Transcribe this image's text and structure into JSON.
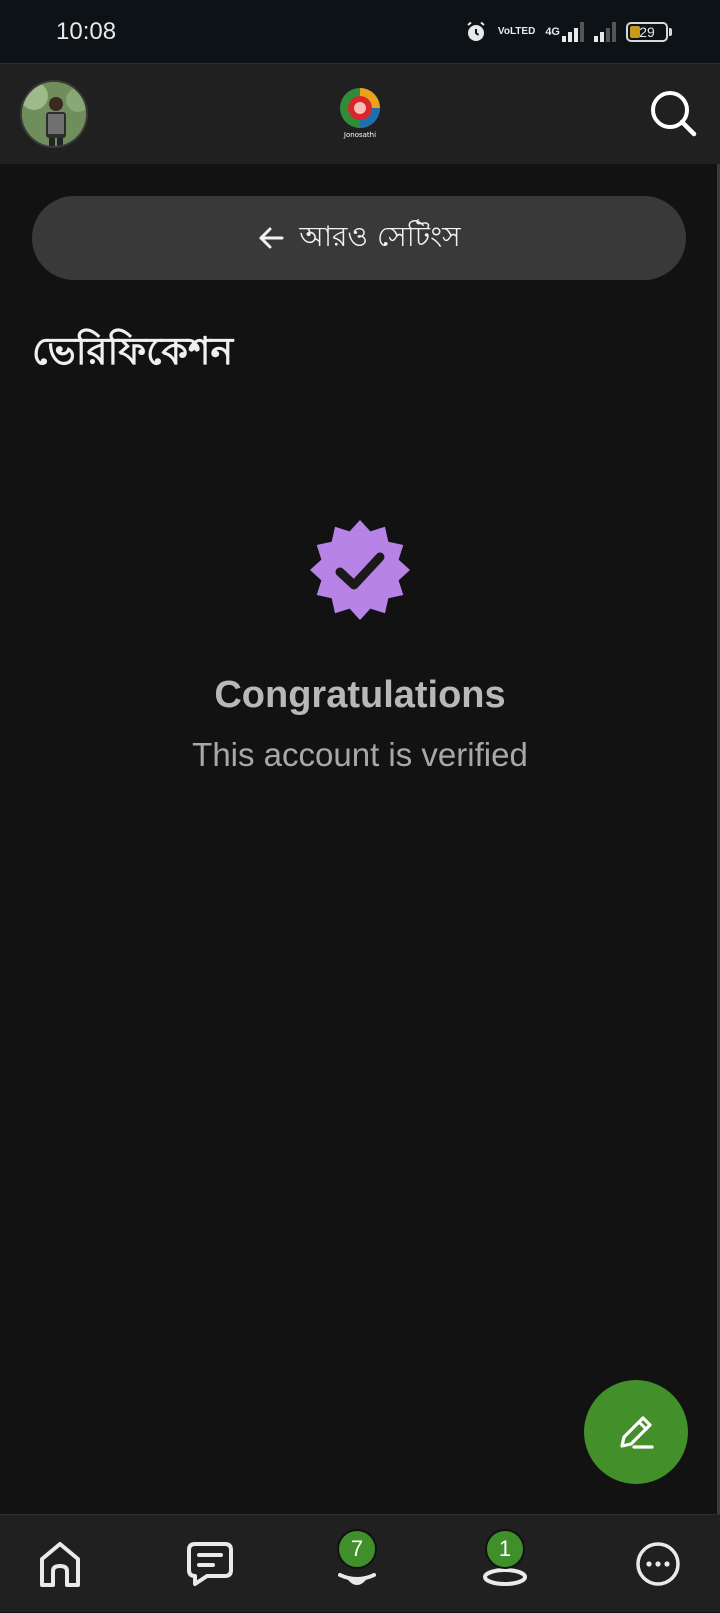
{
  "status_bar": {
    "time": "10:08",
    "network_label_top": "Vo",
    "network_label_bottom": "LTED",
    "network_type": "4G",
    "battery_level": "29"
  },
  "header": {
    "logo_text": "Jonosathi",
    "avatar_icon": "user-avatar",
    "search_icon": "search-icon"
  },
  "back_button": {
    "label": "আরও সেটিংস",
    "icon": "arrow-left-icon"
  },
  "page": {
    "title": "ভেরিফিকেশন"
  },
  "verification": {
    "badge_icon": "verified-badge-icon",
    "badge_color": "#b783e6",
    "heading": "Congratulations",
    "message": "This account is verified"
  },
  "fab": {
    "icon": "pencil-icon",
    "color": "#43902a"
  },
  "bottom_nav": {
    "items": [
      {
        "name": "home",
        "icon": "home-icon",
        "badge": ""
      },
      {
        "name": "messages",
        "icon": "chat-icon",
        "badge": ""
      },
      {
        "name": "notifications",
        "icon": "bell-icon",
        "badge": "7"
      },
      {
        "name": "profile",
        "icon": "user-icon",
        "badge": "1"
      },
      {
        "name": "more",
        "icon": "more-icon",
        "badge": ""
      }
    ]
  }
}
